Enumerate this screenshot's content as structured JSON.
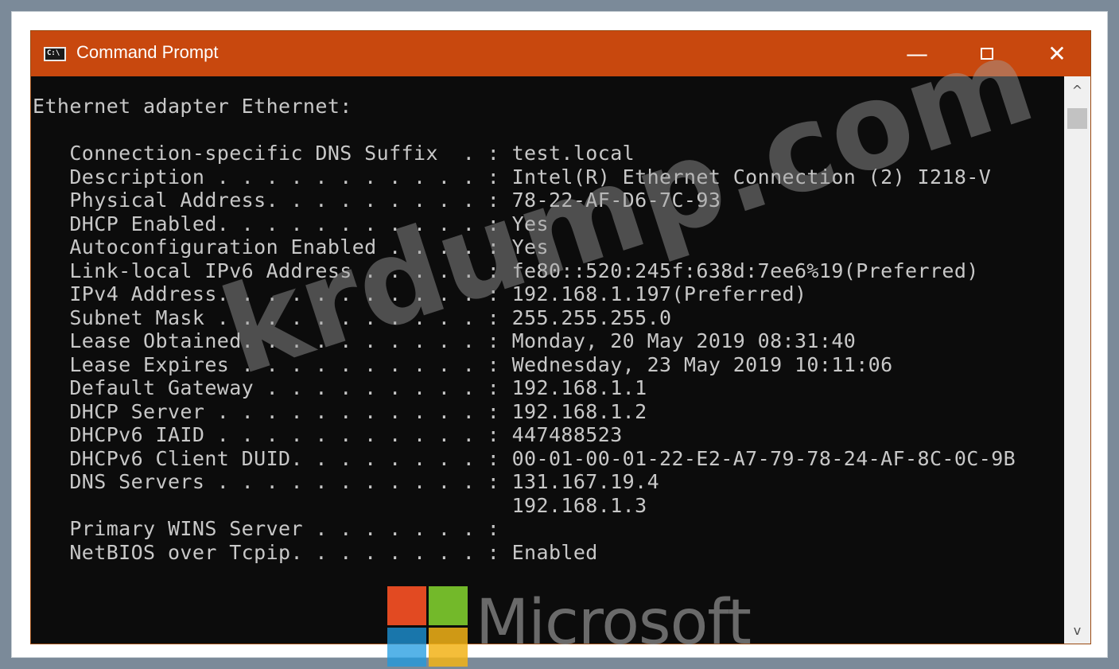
{
  "window": {
    "title": "Command Prompt",
    "icon": "cmd-icon",
    "controls": {
      "minimize": "—",
      "maximize": "",
      "close": "✕"
    },
    "titlebar_color": "#c8480e",
    "console_background": "#0c0c0c",
    "console_text_color": "#c8c8c8"
  },
  "console": {
    "lines": [
      "Ethernet adapter Ethernet:",
      "",
      "   Connection-specific DNS Suffix  . : test.local",
      "   Description . . . . . . . . . . . : Intel(R) Ethernet Connection (2) I218-V",
      "   Physical Address. . . . . . . . . : 78-22-AF-D6-7C-93",
      "   DHCP Enabled. . . . . . . . . . . : Yes",
      "   Autoconfiguration Enabled . . . . : Yes",
      "   Link-local IPv6 Address . . . . . : fe80::520:245f:638d:7ee6%19(Preferred)",
      "   IPv4 Address. . . . . . . . . . . : 192.168.1.197(Preferred)",
      "   Subnet Mask . . . . . . . . . . . : 255.255.255.0",
      "   Lease Obtained. . . . . . . . . . : Monday, 20 May 2019 08:31:40",
      "   Lease Expires . . . . . . . . . . : Wednesday, 23 May 2019 10:11:06",
      "   Default Gateway . . . . . . . . . : 192.168.1.1",
      "   DHCP Server . . . . . . . . . . . : 192.168.1.2",
      "   DHCPv6 IAID . . . . . . . . . . . : 447488523",
      "   DHCPv6 Client DUID. . . . . . . . : 00-01-00-01-22-E2-A7-79-78-24-AF-8C-0C-9B",
      "   DNS Servers . . . . . . . . . . . : 131.167.19.4",
      "                                       192.168.1.3",
      "   Primary WINS Server . . . . . . . :",
      "   NetBIOS over Tcpip. . . . . . . . : Enabled"
    ]
  },
  "scrollbar": {
    "up_arrow": "^",
    "down_arrow": "v"
  },
  "watermark": {
    "text": "krdump.com"
  },
  "logo": {
    "text": "Microsoft",
    "colors": [
      "#e24a22",
      "#73b92a",
      "#1d9ae0",
      "#f2b318"
    ]
  }
}
